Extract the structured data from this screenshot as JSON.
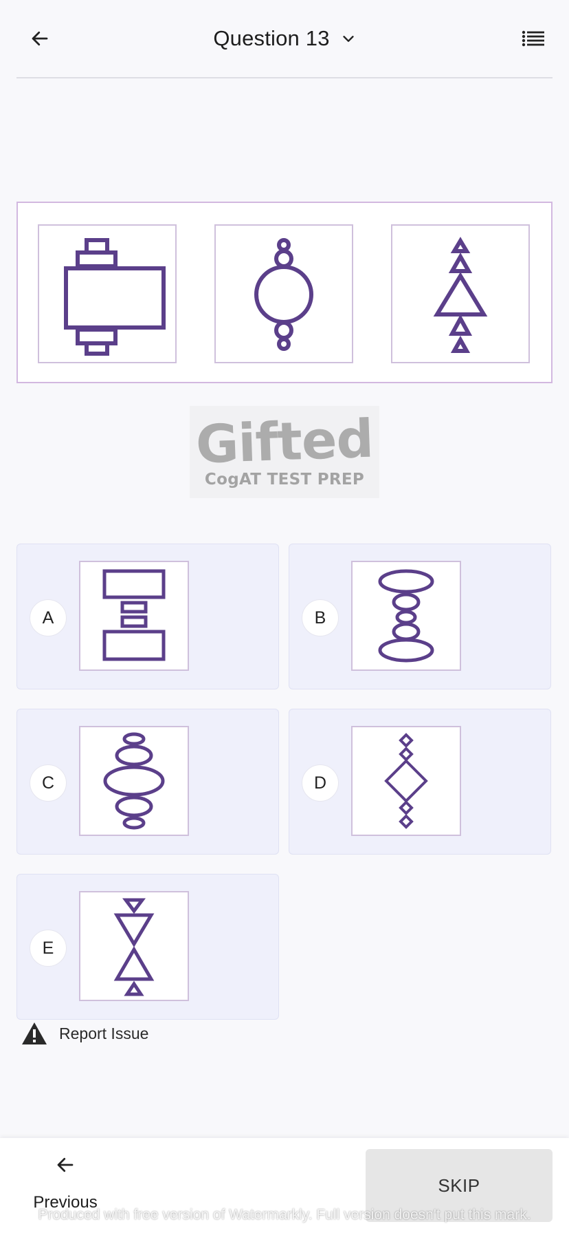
{
  "header": {
    "title": "Question 13",
    "back_icon": "arrow-left-icon",
    "chevron_icon": "chevron-down-icon",
    "list_icon": "question-list-icon"
  },
  "question": {
    "figures": [
      "rectangle-stack-figure",
      "circle-stack-figure",
      "triangle-stack-figure"
    ]
  },
  "logo": {
    "word": "Gifted",
    "tagline": "CogAT TEST PREP"
  },
  "options": [
    {
      "letter": "A",
      "figure": "rectangle-stack-figure"
    },
    {
      "letter": "B",
      "figure": "ellipse-stack-figure"
    },
    {
      "letter": "C",
      "figure": "ellipse-symmetric-figure"
    },
    {
      "letter": "D",
      "figure": "diamond-stack-figure"
    },
    {
      "letter": "E",
      "figure": "inverted-triangle-figure"
    }
  ],
  "report": {
    "label": "Report Issue",
    "icon": "warning-icon"
  },
  "footer": {
    "previous_label": "Previous",
    "skip_label": "SKIP",
    "watermark": "Produced with free version of Watermarkly. Full version doesn't put this mark."
  },
  "colors": {
    "figure_stroke": "#5b3f8a",
    "frame_border": "#cfc0dc",
    "option_bg": "#eff0fb"
  }
}
